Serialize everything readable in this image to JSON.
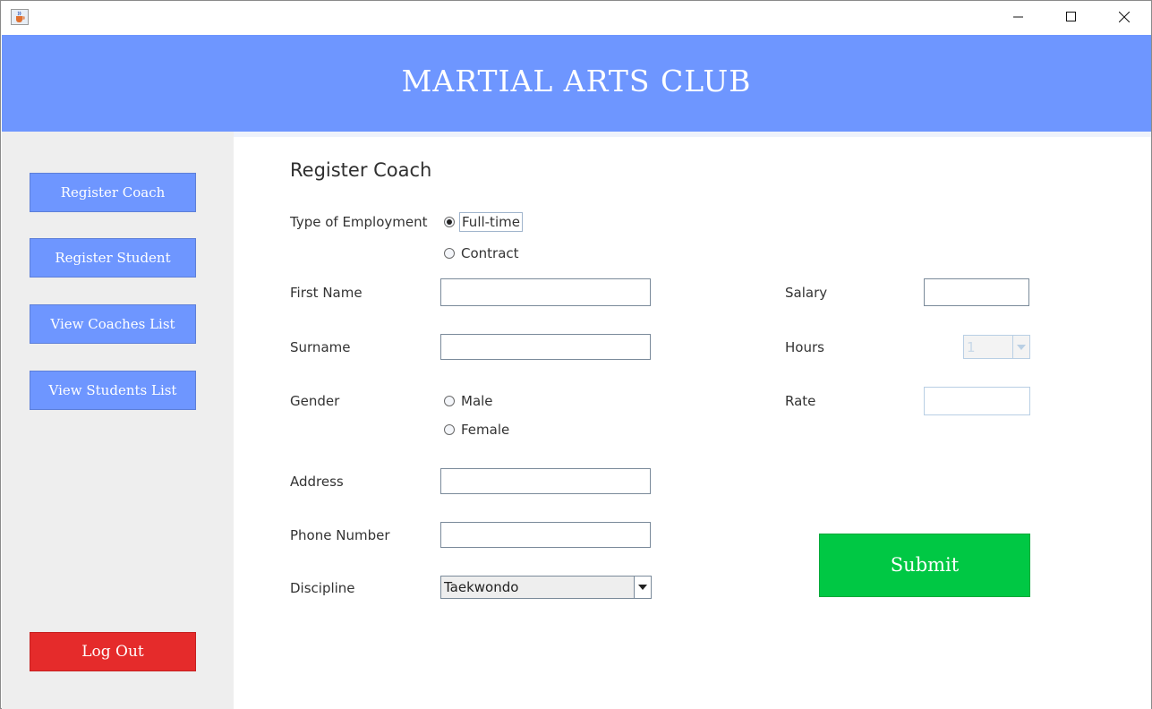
{
  "window": {
    "title": "",
    "icon": "java-cup-icon",
    "controls": [
      "minimize-icon",
      "maximize-icon",
      "close-icon"
    ]
  },
  "header": {
    "title": "MARTIAL ARTS CLUB",
    "background": "#6e96ff"
  },
  "sidebar": {
    "items": [
      {
        "label": "Register Coach"
      },
      {
        "label": "Register Student"
      },
      {
        "label": "View Coaches List"
      },
      {
        "label": "View Students List"
      }
    ],
    "logout_label": "Log Out",
    "logout_color": "#e52b2b"
  },
  "form": {
    "title": "Register Coach",
    "employment": {
      "label": "Type of Employment",
      "options": [
        {
          "label": "Full-time",
          "checked": true
        },
        {
          "label": "Contract",
          "checked": false
        }
      ]
    },
    "first_name": {
      "label": "First Name",
      "value": ""
    },
    "surname": {
      "label": "Surname",
      "value": ""
    },
    "gender": {
      "label": "Gender",
      "options": [
        {
          "label": "Male",
          "checked": false
        },
        {
          "label": "Female",
          "checked": false
        }
      ]
    },
    "address": {
      "label": "Address",
      "value": ""
    },
    "phone": {
      "label": "Phone Number",
      "value": ""
    },
    "discipline": {
      "label": "Discipline",
      "selected": "Taekwondo"
    },
    "salary": {
      "label": "Salary",
      "value": ""
    },
    "hours": {
      "label": "Hours",
      "selected": "1",
      "disabled": true
    },
    "rate": {
      "label": "Rate",
      "value": "",
      "disabled": true
    },
    "submit_label": "Submit",
    "submit_color": "#00c844"
  }
}
